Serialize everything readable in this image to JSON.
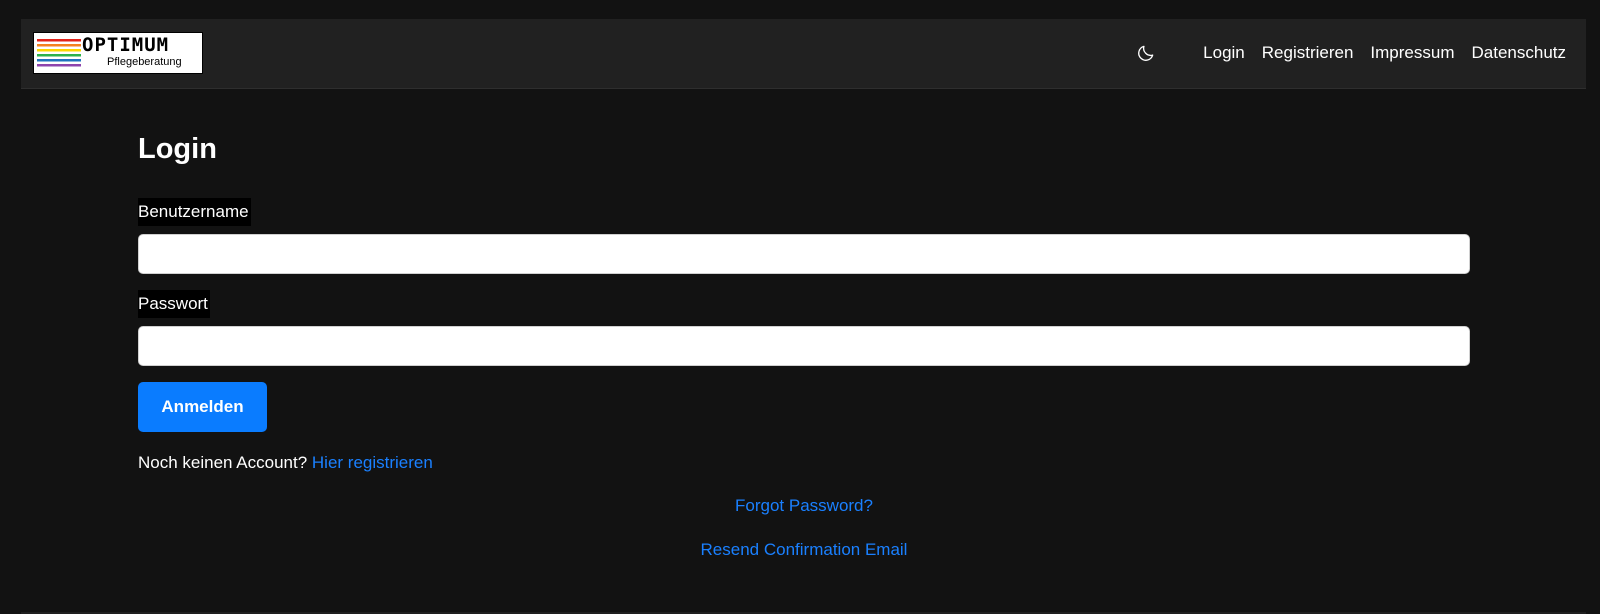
{
  "navbar": {
    "logo": {
      "title": "OPTIMUM",
      "subtitle": "Pflegeberatung",
      "stripe_colors": [
        "#e2231a",
        "#f58220",
        "#fdd800",
        "#2bb24c",
        "#1e73be",
        "#8e44ad"
      ]
    },
    "theme_icon": "moon-icon",
    "links": [
      {
        "label": "Login"
      },
      {
        "label": "Registrieren"
      },
      {
        "label": "Impressum"
      },
      {
        "label": "Datenschutz"
      }
    ]
  },
  "form": {
    "title": "Login",
    "username": {
      "label": "Benutzername",
      "value": "",
      "placeholder": ""
    },
    "password": {
      "label": "Passwort",
      "value": "",
      "placeholder": ""
    },
    "submit_label": "Anmelden",
    "register_prompt": "Noch keinen Account?",
    "register_link": "Hier registrieren",
    "forgot_link": "Forgot Password?",
    "resend_link": "Resend Confirmation Email"
  },
  "colors": {
    "background": "#121212",
    "navbar": "#212121",
    "accent": "#0a7cff",
    "link": "#1a80ff"
  }
}
